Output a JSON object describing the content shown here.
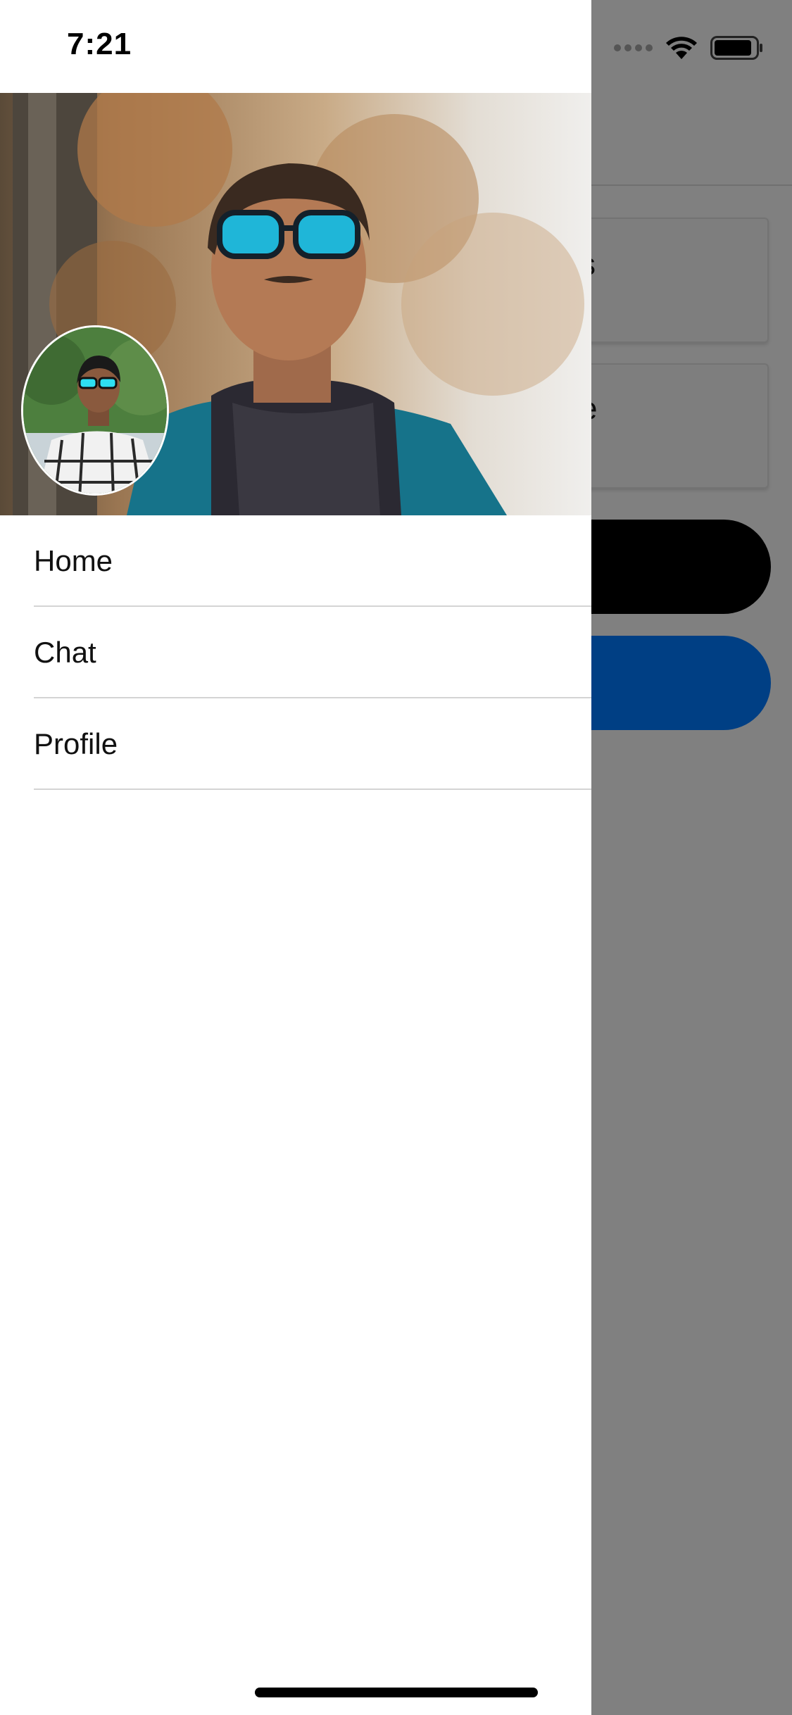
{
  "status_bar": {
    "time": "7:21",
    "icons": [
      "signal-dots-icon",
      "wifi-icon",
      "battery-icon"
    ]
  },
  "background_app": {
    "cards": [
      {
        "visible_text": "s"
      },
      {
        "visible_text": "e"
      }
    ],
    "buttons": [
      {
        "color": "#000000"
      },
      {
        "color": "#003f84"
      }
    ]
  },
  "drawer": {
    "cover_photo": "cover-photo",
    "avatar": "profile-avatar",
    "menu_items": [
      {
        "label": "Home"
      },
      {
        "label": "Chat"
      },
      {
        "label": "Profile"
      }
    ]
  },
  "colors": {
    "overlay": "#808080",
    "drawer_bg": "#ffffff",
    "divider": "#d4d4d4",
    "primary_button": "#003f84"
  }
}
